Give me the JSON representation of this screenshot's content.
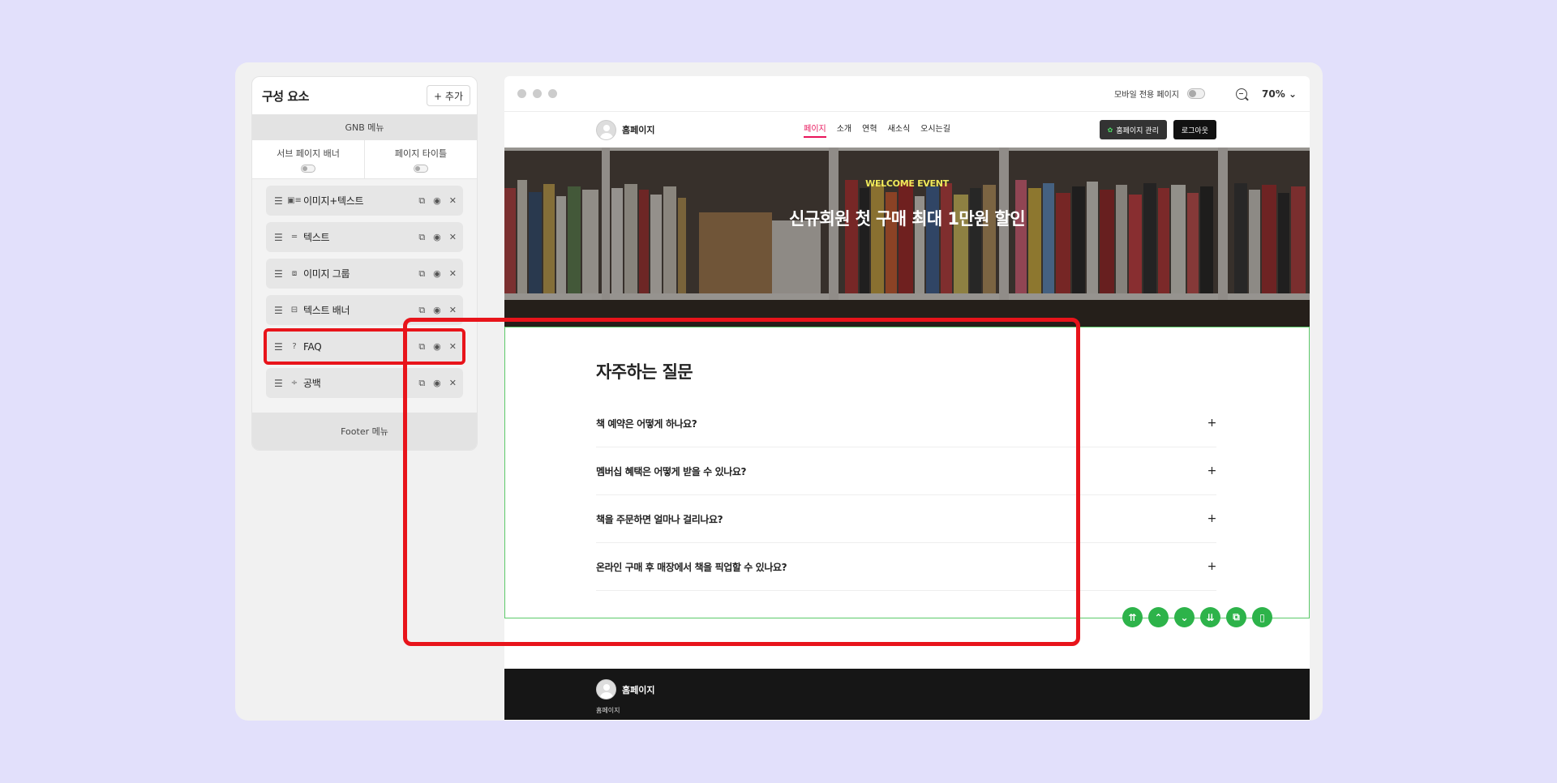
{
  "panel": {
    "title": "구성 요소",
    "add_label": "+ 추가",
    "gnb_label": "GNB 메뉴",
    "toggles": [
      {
        "label": "서브 페이지 배너"
      },
      {
        "label": "페이지 타이틀"
      }
    ],
    "items": [
      {
        "label": "이미지+텍스트",
        "icon": "image-text-icon"
      },
      {
        "label": "텍스트",
        "icon": "text-icon"
      },
      {
        "label": "이미지 그룹",
        "icon": "image-group-icon"
      },
      {
        "label": "텍스트 배너",
        "icon": "text-banner-icon"
      },
      {
        "label": "FAQ",
        "icon": "faq-icon",
        "selected": true
      },
      {
        "label": "공백",
        "icon": "spacing-icon"
      }
    ],
    "footer_label": "Footer 메뉴"
  },
  "preview": {
    "mobile_label": "모바일 전용 페이지",
    "zoom": "70%",
    "site": {
      "brand": "홈페이지",
      "menu": [
        "페이지",
        "소개",
        "연혁",
        "새소식",
        "오시는길"
      ],
      "active_menu": "페이지",
      "manage_label": "홈페이지 관리",
      "logout_label": "로그아웃"
    },
    "hero": {
      "eyebrow": "WELCOME EVENT",
      "title": "신규회원 첫 구매 최대 1만원 할인"
    },
    "faq": {
      "title": "자주하는 질문",
      "questions": [
        "책 예약은 어떻게 하나요?",
        "멤버십 혜택은 어떻게 받을 수 있나요?",
        "책을 주문하면 얼마나 걸리나요?",
        "온라인 구매 후 매장에서 책을 픽업할 수 있나요?"
      ]
    },
    "footer": {
      "brand": "홈페이지",
      "sub": "홈페이지"
    }
  },
  "colors": {
    "background": "#e2e0fb",
    "highlight": "#e8141b",
    "active_menu": "#e8145a",
    "tool_green": "#2db34a",
    "hero_eyebrow": "#f0ea5a"
  }
}
